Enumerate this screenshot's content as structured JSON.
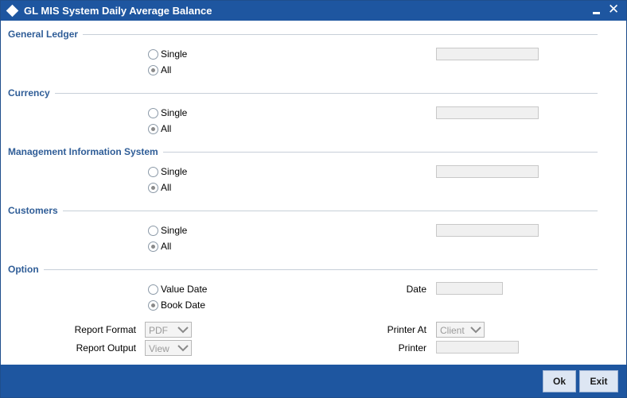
{
  "window": {
    "title": "GL MIS System Daily Average Balance"
  },
  "sections": {
    "general_ledger": {
      "title": "General Ledger",
      "single": "Single",
      "all": "All"
    },
    "currency": {
      "title": "Currency",
      "single": "Single",
      "all": "All"
    },
    "mis": {
      "title": "Management Information System",
      "single": "Single",
      "all": "All"
    },
    "customers": {
      "title": "Customers",
      "single": "Single",
      "all": "All"
    },
    "option": {
      "title": "Option",
      "value_date": "Value Date",
      "book_date": "Book Date",
      "date_label": "Date"
    }
  },
  "report": {
    "format_label": "Report Format",
    "format_value": "PDF",
    "output_label": "Report Output",
    "output_value": "View",
    "printer_at_label": "Printer At",
    "printer_at_value": "Client",
    "printer_label": "Printer"
  },
  "buttons": {
    "ok": "Ok",
    "exit": "Exit"
  },
  "icons": {
    "title_icon": "diamond-icon",
    "minimize": "minimize-icon",
    "close": "close-icon",
    "dropdown": "chevron-down-icon"
  },
  "colors": {
    "titlebar": "#1e56a0",
    "section_heading": "#2f5d97",
    "footer": "#1e56a0"
  }
}
